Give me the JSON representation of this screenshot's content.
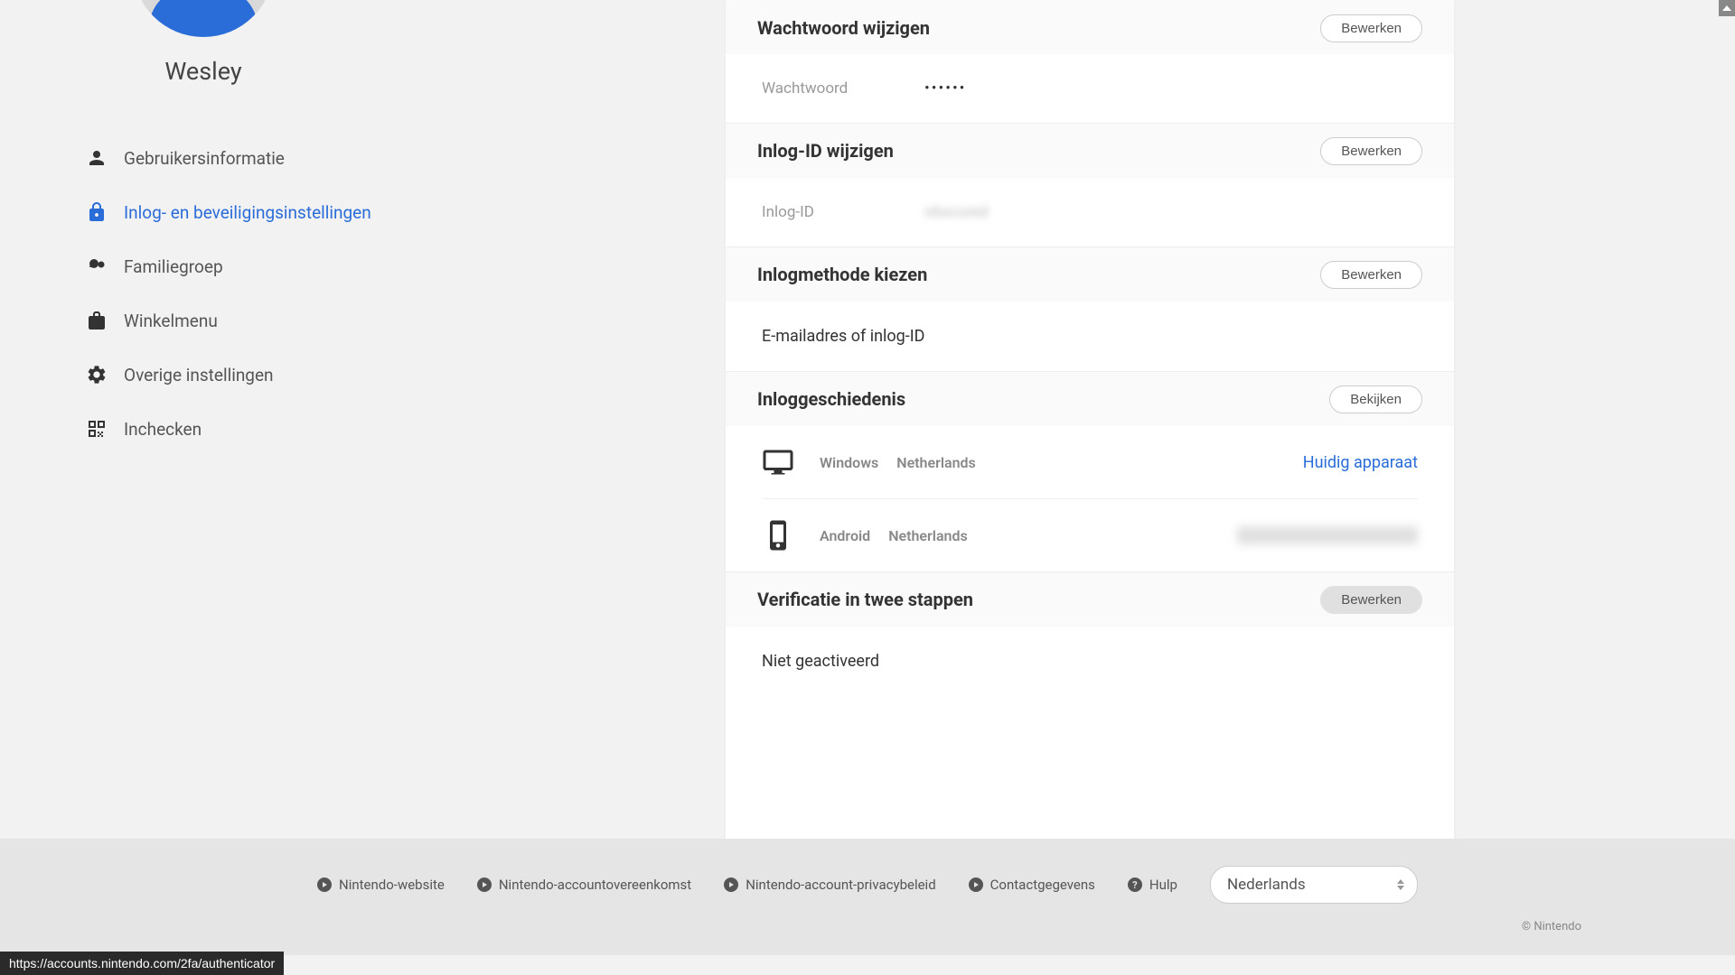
{
  "profile": {
    "username": "Wesley"
  },
  "nav": {
    "items": [
      {
        "label": "Gebruikersinformatie",
        "icon": "person-icon"
      },
      {
        "label": "Inlog- en beveiligingsinstellingen",
        "icon": "lock-icon"
      },
      {
        "label": "Familiegroep",
        "icon": "family-icon"
      },
      {
        "label": "Winkelmenu",
        "icon": "shop-icon"
      },
      {
        "label": "Overige instellingen",
        "icon": "gear-icon"
      },
      {
        "label": "Inchecken",
        "icon": "qr-icon"
      }
    ]
  },
  "sections": {
    "password": {
      "title": "Wachtwoord wijzigen",
      "button": "Bewerken",
      "label": "Wachtwoord",
      "value": "••••••"
    },
    "loginId": {
      "title": "Inlog-ID wijzigen",
      "button": "Bewerken",
      "label": "Inlog-ID",
      "value": "obscured"
    },
    "loginMethod": {
      "title": "Inlogmethode kiezen",
      "button": "Bewerken",
      "value": "E-mailadres of inlog-ID"
    },
    "history": {
      "title": "Inloggeschiedenis",
      "button": "Bekijken",
      "rows": [
        {
          "os": "Windows",
          "location": "Netherlands",
          "status": "Huidig apparaat"
        },
        {
          "os": "Android",
          "location": "Netherlands",
          "status": ""
        }
      ]
    },
    "twoFactor": {
      "title": "Verificatie in twee stappen",
      "button": "Bewerken",
      "value": "Niet geactiveerd"
    }
  },
  "footer": {
    "links": [
      "Nintendo-website",
      "Nintendo-accountovereenkomst",
      "Nintendo-account-privacybeleid",
      "Contactgegevens",
      "Hulp"
    ],
    "language": "Nederlands",
    "copyright": "© Nintendo"
  },
  "statusBar": {
    "url": "https://accounts.nintendo.com/2fa/authenticator"
  }
}
